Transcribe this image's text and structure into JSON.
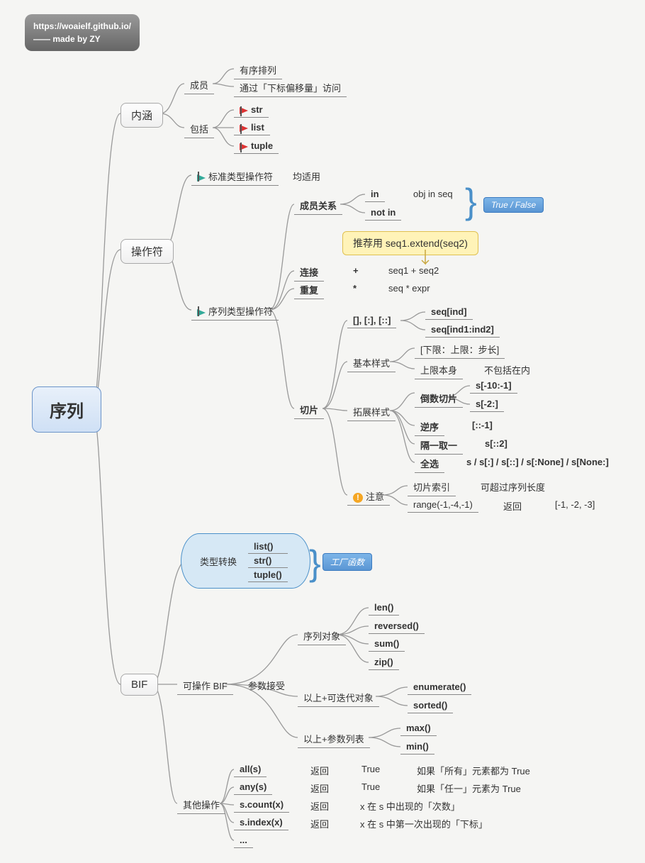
{
  "badge": {
    "url": "https://woaielf.github.io/",
    "credit": "—— made by ZY"
  },
  "root": "序列",
  "b1": "内涵",
  "b2": "操作符",
  "b3": "BIF",
  "connotation": {
    "members": "成员",
    "members_sub": [
      "有序排列",
      "通过「下标偏移量」访问"
    ],
    "includes": "包括",
    "includes_sub": [
      "str",
      "list",
      "tuple"
    ]
  },
  "operators": {
    "standard": "标准类型操作符",
    "standard_note": "均适用",
    "seq": "序列类型操作符",
    "membership": {
      "t": "成员关系",
      "ops": [
        [
          "in",
          "obj in seq"
        ],
        [
          "not in",
          ""
        ]
      ],
      "result": "True / False"
    },
    "connect": {
      "t": "连接",
      "sym": "+",
      "expr": "seq1 + seq2"
    },
    "connect_tip": "推荐用 seq1.extend(seq2)",
    "repeat": {
      "t": "重复",
      "sym": "*",
      "expr": "seq * expr"
    },
    "slice": {
      "t": "切片",
      "basic_bracket": "[], [:], [::]",
      "basic_sub": [
        "seq[ind]",
        "seq[ind1:ind2]"
      ],
      "basic": {
        "t": "基本样式",
        "a": "[下限：上限：步长]",
        "b": "上限本身",
        "b2": "不包括在内"
      },
      "ext": {
        "t": "拓展样式",
        "rev_slice": "倒数切片",
        "rev_vals": [
          "s[-10:-1]",
          "s[-2:]"
        ],
        "reverse": "逆序",
        "reverse_val": "[::-1]",
        "step": "隔一取一",
        "step_val": "s[::2]",
        "all": "全选",
        "all_val": "s / s[:] / s[::] / s[:None] / s[None:]"
      },
      "note": {
        "t": "注意",
        "a": "切片索引",
        "a2": "可超过序列长度",
        "b": "range(-1,-4,-1)",
        "b2": "返回",
        "b3": "[-1, -2, -3]"
      }
    }
  },
  "bif": {
    "typeconv": {
      "t": "类型转换",
      "fns": [
        "list()",
        "str()",
        "tuple()"
      ],
      "tag": "工厂函数"
    },
    "operable": {
      "t": "可操作 BIF",
      "param": "参数接受",
      "seq_obj": "序列对象",
      "seq_fns": [
        "len()",
        "reversed()",
        "sum()",
        "zip()"
      ],
      "iter": "以上+可迭代对象",
      "iter_fns": [
        "enumerate()",
        "sorted()"
      ],
      "args": "以上+参数列表",
      "args_fns": [
        "max()",
        "min()"
      ]
    },
    "other": {
      "t": "其他操作",
      "rows": [
        [
          "all(s)",
          "返回",
          "True",
          "如果「所有」元素都为 True"
        ],
        [
          "any(s)",
          "返回",
          "True",
          "如果「任一」元素为 True"
        ],
        [
          "s.count(x)",
          "返回",
          "x 在 s 中出现的「次数」",
          ""
        ],
        [
          "s.index(x)",
          "返回",
          "x 在 s 中第一次出现的「下标」",
          ""
        ],
        [
          "...",
          "",
          "",
          ""
        ]
      ]
    }
  }
}
